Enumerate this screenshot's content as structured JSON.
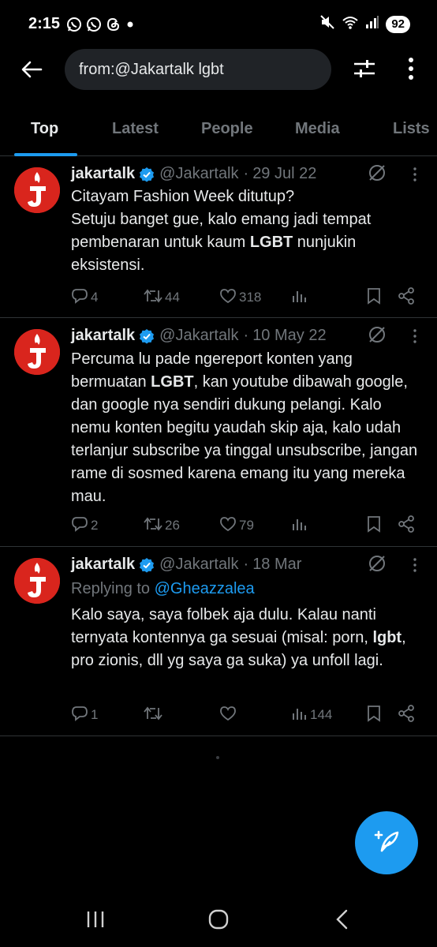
{
  "status_bar": {
    "time": "2:15",
    "battery": "92"
  },
  "search": {
    "query": "from:@Jakartalk lgbt"
  },
  "tabs": [
    {
      "label": "Top",
      "active": true
    },
    {
      "label": "Latest"
    },
    {
      "label": "People"
    },
    {
      "label": "Media"
    },
    {
      "label": "Lists"
    }
  ],
  "tweets": [
    {
      "name": "jakartalk",
      "handle": "@Jakartalk",
      "separator": "·",
      "date": "29 Jul 22",
      "text_parts": [
        "Citayam Fashion Week ditutup?\nSetuju banget gue, kalo emang jadi tempat pembenaran untuk kaum ",
        "LGBT",
        " nunjukin eksistensi."
      ],
      "replies": "4",
      "retweets": "44",
      "likes": "318",
      "views": ""
    },
    {
      "name": "jakartalk",
      "handle": "@Jakartalk",
      "separator": "·",
      "date": "10 May 22",
      "text_parts": [
        "Percuma lu pade ngereport konten yang bermuatan ",
        "LGBT",
        ", kan youtube dibawah google, dan google nya sendiri dukung pelangi. Kalo nemu konten begitu yaudah skip aja, kalo udah terlanjur subscribe ya tinggal unsubscribe, jangan rame di sosmed karena emang itu yang mereka mau."
      ],
      "replies": "2",
      "retweets": "26",
      "likes": "79",
      "views": ""
    },
    {
      "name": "jakartalk",
      "handle": "@Jakartalk",
      "separator": "·",
      "date": "18 Mar",
      "replying_label": "Replying to",
      "replying_to": "@Gheazzalea",
      "text_parts": [
        "Kalo saya, saya folbek aja dulu. Kalau nanti ternyata kontennya ga sesuai (misal: porn, ",
        "lgbt",
        ", pro zionis, dll yg saya ga suka) ya unfoll lagi."
      ],
      "replies": "1",
      "retweets": "",
      "likes": "",
      "views": "144"
    }
  ],
  "colors": {
    "accent": "#1d9bf0",
    "background": "#000000",
    "muted": "#71767b",
    "avatar": "#d9251d"
  },
  "icons": [
    "back-arrow-icon",
    "filter-sliders-icon",
    "more-vertical-icon",
    "verified-badge-icon",
    "grok-icon",
    "reply-icon",
    "retweet-icon",
    "like-icon",
    "views-icon",
    "bookmark-icon",
    "share-icon",
    "compose-icon"
  ]
}
